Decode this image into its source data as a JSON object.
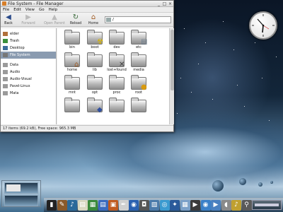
{
  "window": {
    "title": "File System - File Manager",
    "controls": {
      "minimize": "_",
      "maximize": "□",
      "close": "×"
    }
  },
  "menu": [
    "File",
    "Edit",
    "View",
    "Go",
    "Help"
  ],
  "toolbar": {
    "back": "Back",
    "forward": "Forward",
    "open_parent": "Open Parent",
    "reload": "Reload",
    "home": "Home",
    "address": "/"
  },
  "sidebar": {
    "group1": [
      {
        "label": "elder",
        "icon": "home-folder-icon",
        "color": "#b0703a"
      },
      {
        "label": "Trash",
        "icon": "trash-icon",
        "color": "#3a8f3a"
      },
      {
        "label": "Desktop",
        "icon": "desktop-icon",
        "color": "#3c6d9a"
      },
      {
        "label": "File System",
        "icon": "drive-icon",
        "color": "#777777",
        "selected": true
      }
    ],
    "group2": [
      {
        "label": "Data",
        "icon": "folder-icon",
        "color": "#9a9a9a"
      },
      {
        "label": "Audio",
        "icon": "folder-icon",
        "color": "#9a9a9a"
      },
      {
        "label": "Audio-Visual",
        "icon": "folder-icon",
        "color": "#9a9a9a"
      },
      {
        "label": "Pavel-Linux",
        "icon": "folder-icon",
        "color": "#9a9a9a"
      },
      {
        "label": "Mata",
        "icon": "folder-icon",
        "color": "#9a9a9a"
      }
    ]
  },
  "files": [
    {
      "name": "bin",
      "emblem": "",
      "emblem_color": ""
    },
    {
      "name": "boot",
      "emblem": "☢",
      "emblem_color": "#d8b400"
    },
    {
      "name": "dev",
      "emblem": "",
      "emblem_color": ""
    },
    {
      "name": "etc",
      "emblem": "▤",
      "emblem_color": "#6f7f8f"
    },
    {
      "name": "home",
      "emblem": "⌂",
      "emblem_color": "#a05a20"
    },
    {
      "name": "lib",
      "emblem": "",
      "emblem_color": ""
    },
    {
      "name": "lost+found",
      "emblem": "✕",
      "emblem_color": "#444444"
    },
    {
      "name": "media",
      "emblem": "",
      "emblem_color": ""
    },
    {
      "name": "mnt",
      "emblem": "",
      "emblem_color": ""
    },
    {
      "name": "opt",
      "emblem": "",
      "emblem_color": ""
    },
    {
      "name": "proc",
      "emblem": "",
      "emblem_color": ""
    },
    {
      "name": "root",
      "emblem": "●",
      "emblem_color": "#d89a10"
    },
    {
      "name": "",
      "emblem": "",
      "emblem_color": ""
    },
    {
      "name": "",
      "emblem": "◆",
      "emblem_color": "#3050a0"
    },
    {
      "name": "",
      "emblem": "",
      "emblem_color": ""
    },
    {
      "name": "",
      "emblem": "",
      "emblem_color": ""
    }
  ],
  "status": "17 items (69.2 kB), Free space: 965.3 MB",
  "dock": {
    "icons": [
      {
        "name": "terminal-icon",
        "color": "#222222",
        "glyph": "▮"
      },
      {
        "name": "tools-icon",
        "color": "#8a5a2a",
        "glyph": "✎"
      },
      {
        "name": "media-icon",
        "color": "#2a6a9a",
        "glyph": "♪"
      },
      {
        "name": "notes-icon",
        "color": "#d8d8c0",
        "glyph": "▤"
      },
      {
        "name": "spreadsheet-icon",
        "color": "#3a8a3a",
        "glyph": "▦"
      },
      {
        "name": "writer-icon",
        "color": "#3a6abf",
        "glyph": "▤"
      },
      {
        "name": "presentation-icon",
        "color": "#c05a20",
        "glyph": "▣"
      },
      {
        "name": "pen-icon",
        "color": "#d0d0d0",
        "glyph": "✒"
      },
      {
        "name": "web-browser-icon",
        "color": "#2a60b0",
        "glyph": "◉"
      },
      {
        "name": "camera-icon",
        "color": "#555555",
        "glyph": "◘"
      },
      {
        "name": "photo-icon",
        "color": "#4a7aaa",
        "glyph": "▧"
      },
      {
        "name": "eye-icon",
        "color": "#3a9ad0",
        "glyph": "◎"
      },
      {
        "name": "network-icon",
        "color": "#2a5a9a",
        "glyph": "✦"
      },
      {
        "name": "calendar-icon",
        "color": "#7aa0c8",
        "glyph": "▦"
      },
      {
        "name": "clapper-icon",
        "color": "#3a3a3a",
        "glyph": "▶"
      },
      {
        "name": "disc-icon",
        "color": "#3a80c8",
        "glyph": "◉"
      },
      {
        "name": "play-icon",
        "color": "#4a80c0",
        "glyph": "▶"
      },
      {
        "name": "mouse-icon",
        "color": "#8a8a8a",
        "glyph": "◖"
      },
      {
        "name": "audio-icon",
        "color": "#c0a030",
        "glyph": "♪"
      },
      {
        "name": "search-icon",
        "color": "#5a5a5a",
        "glyph": "⚲"
      }
    ]
  }
}
